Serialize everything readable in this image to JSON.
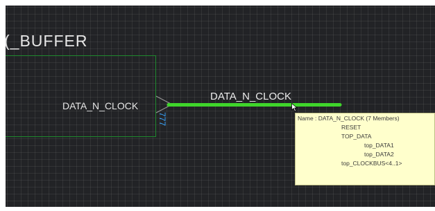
{
  "schematic": {
    "component_title": "(_BUFFER",
    "pin_name": "DATA_N_CLOCK",
    "pin_number": "777",
    "net_label": "DATA_N_CLOCK",
    "colors": {
      "background": "#222326",
      "grid": "#393a3d",
      "component_outline": "#1f8a2e",
      "wire": "#3fd52b",
      "pin_number": "#3aa6ff",
      "tooltip_bg": "#ffffcc"
    }
  },
  "tooltip": {
    "name_line": "Name : DATA_N_CLOCK (7 Members)",
    "members": [
      "RESET",
      "TOP_DATA",
      "top_DATA1",
      "top_DATA2",
      "top_CLOCKBUS<4..1>"
    ]
  },
  "icons": {
    "cursor": "mouse-pointer-icon"
  }
}
